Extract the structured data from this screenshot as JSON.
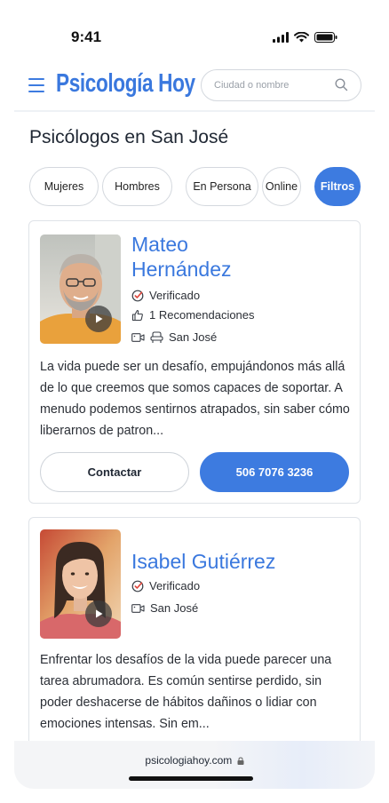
{
  "status": {
    "time": "9:41"
  },
  "header": {
    "logo": "Psicología Hoy",
    "search_placeholder": "Ciudad o nombre"
  },
  "page": {
    "title": "Psicólogos en San José"
  },
  "filters": [
    {
      "label": "Mujeres",
      "active": false
    },
    {
      "label": "Hombres",
      "active": false
    },
    {
      "label": "En Persona",
      "active": false
    },
    {
      "label": "Online",
      "active": false
    },
    {
      "label": "Filtros",
      "active": true
    }
  ],
  "profiles": [
    {
      "name_line1": "Mateo",
      "name_line2": "Hernández",
      "verified": "Verificado",
      "recommendations": "1 Recomendaciones",
      "location": "San José",
      "description": "La vida puede ser un desafío, empujándonos más allá de lo que creemos que somos capaces de soportar. A menudo podemos sentirnos atrapados, sin saber cómo liberarnos de patron...",
      "contact_label": "Contactar",
      "phone": "506 7076 3236"
    },
    {
      "name": "Isabel Gutiérrez",
      "verified": "Verificado",
      "location": "San José",
      "description": "Enfrentar los desafíos de la vida puede parecer una tarea abrumadora. Es común sentirse perdido, sin poder deshacerse de hábitos dañinos o lidiar con emociones intensas. Sin em..."
    }
  ],
  "browser": {
    "url": "psicologiahoy.com"
  },
  "colors": {
    "accent": "#3d7be0",
    "verified_check": "#e0453b"
  }
}
